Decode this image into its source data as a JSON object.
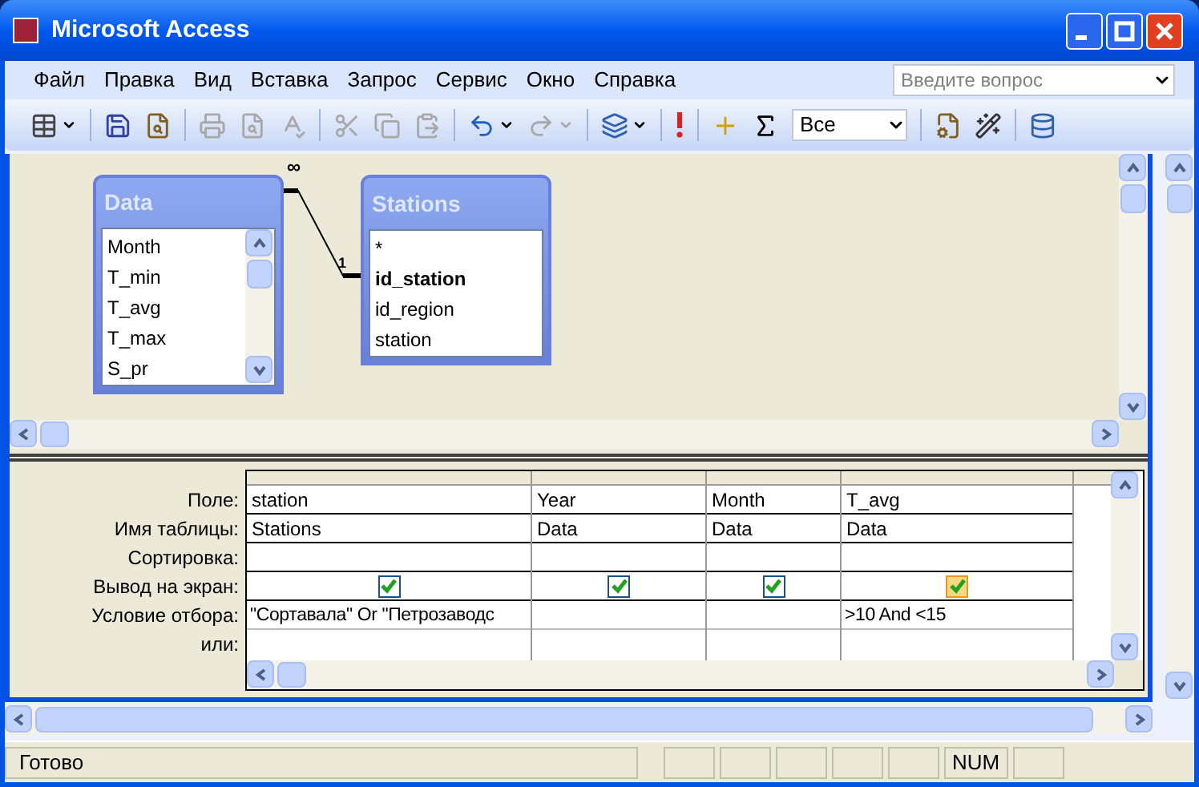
{
  "window": {
    "title": "Microsoft Access"
  },
  "menu": [
    "Файл",
    "Правка",
    "Вид",
    "Вставка",
    "Запрос",
    "Сервис",
    "Окно",
    "Справка"
  ],
  "help_search": {
    "placeholder": "Введите вопрос"
  },
  "toolbar": {
    "filter_value": "Все"
  },
  "diagram": {
    "tables": [
      {
        "title": "Data",
        "fields": [
          {
            "name": "Month",
            "bold": false
          },
          {
            "name": "T_min",
            "bold": false
          },
          {
            "name": "T_avg",
            "bold": false
          },
          {
            "name": "T_max",
            "bold": false
          },
          {
            "name": "S_pr",
            "bold": false
          }
        ],
        "scrollable": true
      },
      {
        "title": "Stations",
        "fields": [
          {
            "name": "*",
            "bold": false
          },
          {
            "name": "id_station",
            "bold": true
          },
          {
            "name": "id_region",
            "bold": false
          },
          {
            "name": "station",
            "bold": false
          }
        ],
        "scrollable": false
      }
    ],
    "relationship": {
      "many_label": "∞",
      "one_label": "1"
    }
  },
  "grid": {
    "row_labels": [
      "Поле:",
      "Имя таблицы:",
      "Сортировка:",
      "Вывод на экран:",
      "Условие отбора:",
      "или:"
    ],
    "columns": [
      {
        "field": "station",
        "table": "Stations",
        "show": true,
        "focused": false,
        "criteria": "\"Сортавала\" Or \"Петрозаводс"
      },
      {
        "field": "Year",
        "table": "Data",
        "show": true,
        "focused": false
      },
      {
        "field": "Month",
        "table": "Data",
        "show": true,
        "focused": false
      },
      {
        "field": "T_avg",
        "table": "Data",
        "show": true,
        "focused": true,
        "criteria": ">10 And <15"
      }
    ]
  },
  "status_bar": {
    "message": "Готово",
    "indicator": "NUM"
  }
}
